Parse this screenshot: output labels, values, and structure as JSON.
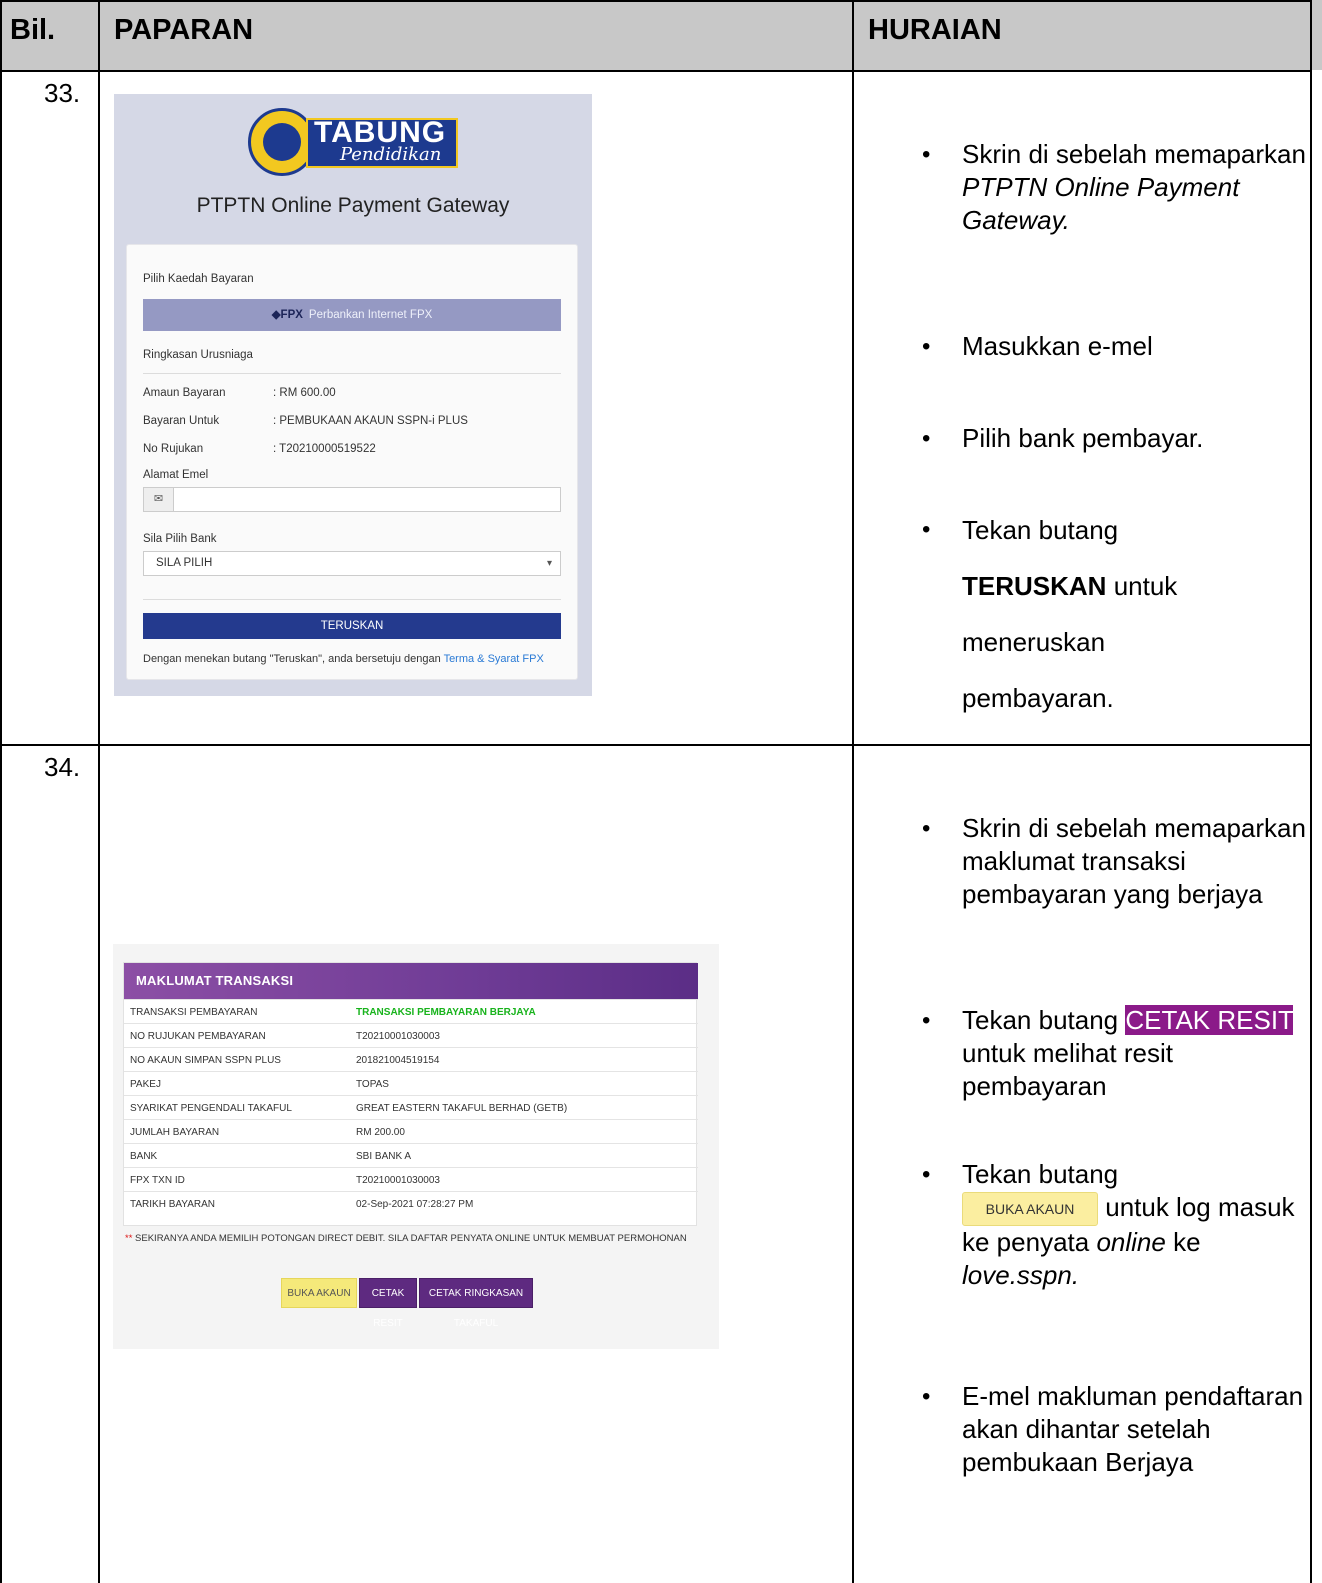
{
  "table": {
    "headers": {
      "bil": "Bil.",
      "paparan": "PAPARAN",
      "huraian": "HURAIAN"
    },
    "rows": [
      {
        "number": "33."
      },
      {
        "number": "34."
      }
    ]
  },
  "gateway": {
    "logo": {
      "text_main": "TABUNG",
      "text_sub": "Pendidikan"
    },
    "title": "PTPTN Online Payment Gateway",
    "payment_method_label": "Pilih Kaedah Bayaran",
    "fpx_logo": "FPX",
    "fpx_option": "Perbankan Internet FPX",
    "summary_label": "Ringkasan Urusniaga",
    "details": [
      {
        "key": "Amaun Bayaran",
        "value": ": RM 600.00"
      },
      {
        "key": "Bayaran Untuk",
        "value": ": PEMBUKAAN AKAUN SSPN-i PLUS"
      },
      {
        "key": "No Rujukan",
        "value": ": T20210000519522"
      }
    ],
    "email_label": "Alamat Emel",
    "email_value": "",
    "bank_label": "Sila Pilih Bank",
    "bank_selected": "SILA PILIH",
    "continue_button": "TERUSKAN",
    "terms_text": "Dengan menekan butang \"Teruskan\", anda bersetuju dengan",
    "terms_link": "Terma & Syarat FPX"
  },
  "transaction": {
    "header": "MAKLUMAT TRANSAKSI",
    "rows": [
      {
        "key": "TRANSAKSI PEMBAYARAN",
        "value": "TRANSAKSI PEMBAYARAN BERJAYA"
      },
      {
        "key": "NO RUJUKAN PEMBAYARAN",
        "value": "T20210001030003"
      },
      {
        "key": "NO AKAUN SIMPAN SSPN PLUS",
        "value": "201821004519154"
      },
      {
        "key": "PAKEJ",
        "value": "TOPAS"
      },
      {
        "key": "SYARIKAT PENGENDALI TAKAFUL",
        "value": "GREAT EASTERN TAKAFUL BERHAD (GETB)"
      },
      {
        "key": "JUMLAH BAYARAN",
        "value": "RM 200.00"
      },
      {
        "key": "BANK",
        "value": "SBI BANK A"
      },
      {
        "key": "FPX TXN ID",
        "value": "T20210001030003"
      },
      {
        "key": "TARIKH BAYARAN",
        "value": "02-Sep-2021 07:28:27 PM"
      }
    ],
    "note_marker": "**",
    "note": "SEKIRANYA ANDA MEMILIH POTONGAN DIRECT DEBIT. SILA DAFTAR PENYATA ONLINE UNTUK MEMBUAT PERMOHONAN",
    "buttons": {
      "buka": "BUKA AKAUN",
      "cetak": "CETAK RESIT",
      "ringkasan": "CETAK RINGKASAN TAKAFUL"
    }
  },
  "desc33": {
    "b1_pre": "Skrin di sebelah memaparkan ",
    "b1_em": "PTPTN Online Payment Gateway.",
    "b2": "Masukkan e-mel",
    "b3": "Pilih bank pembayar.",
    "b4_pre": "Tekan butang",
    "b4_strong": "TERUSKAN",
    "b4_post1": "untuk",
    "b4_post2": "meneruskan",
    "b4_post3": "pembayaran."
  },
  "desc34": {
    "b1": "Skrin di sebelah memaparkan maklumat transaksi pembayaran yang berjaya",
    "b2_pre": "Tekan butang",
    "b2_hl": "CETAK RESIT",
    "b2_post": "untuk melihat resit pembayaran",
    "b3_pre": "Tekan butang",
    "b3_button": "BUKA AKAUN",
    "b3_post1": "untuk log masuk ke penyata ",
    "b3_em1": "online",
    "b3_post2": " ke ",
    "b3_em2": "love.sspn.",
    "b4": "E-mel makluman pendaftaran akan dihantar setelah pembukaan Berjaya"
  },
  "colors": {
    "header_bg": "#c8c8c8",
    "gateway_bg": "#d5d8e6",
    "fpx_bar": "#9599c3",
    "continue_button": "#243a8e",
    "transaction_header": "#6f3c96",
    "success_text": "#18b31c",
    "buka_button": "#f5e97a",
    "cetak_button": "#5e2a80",
    "highlight_resit": "#8b1a89"
  },
  "icons": {
    "email": "envelope-icon",
    "select": "chevron-down-icon",
    "fpx": "fpx-diamond-icon"
  }
}
